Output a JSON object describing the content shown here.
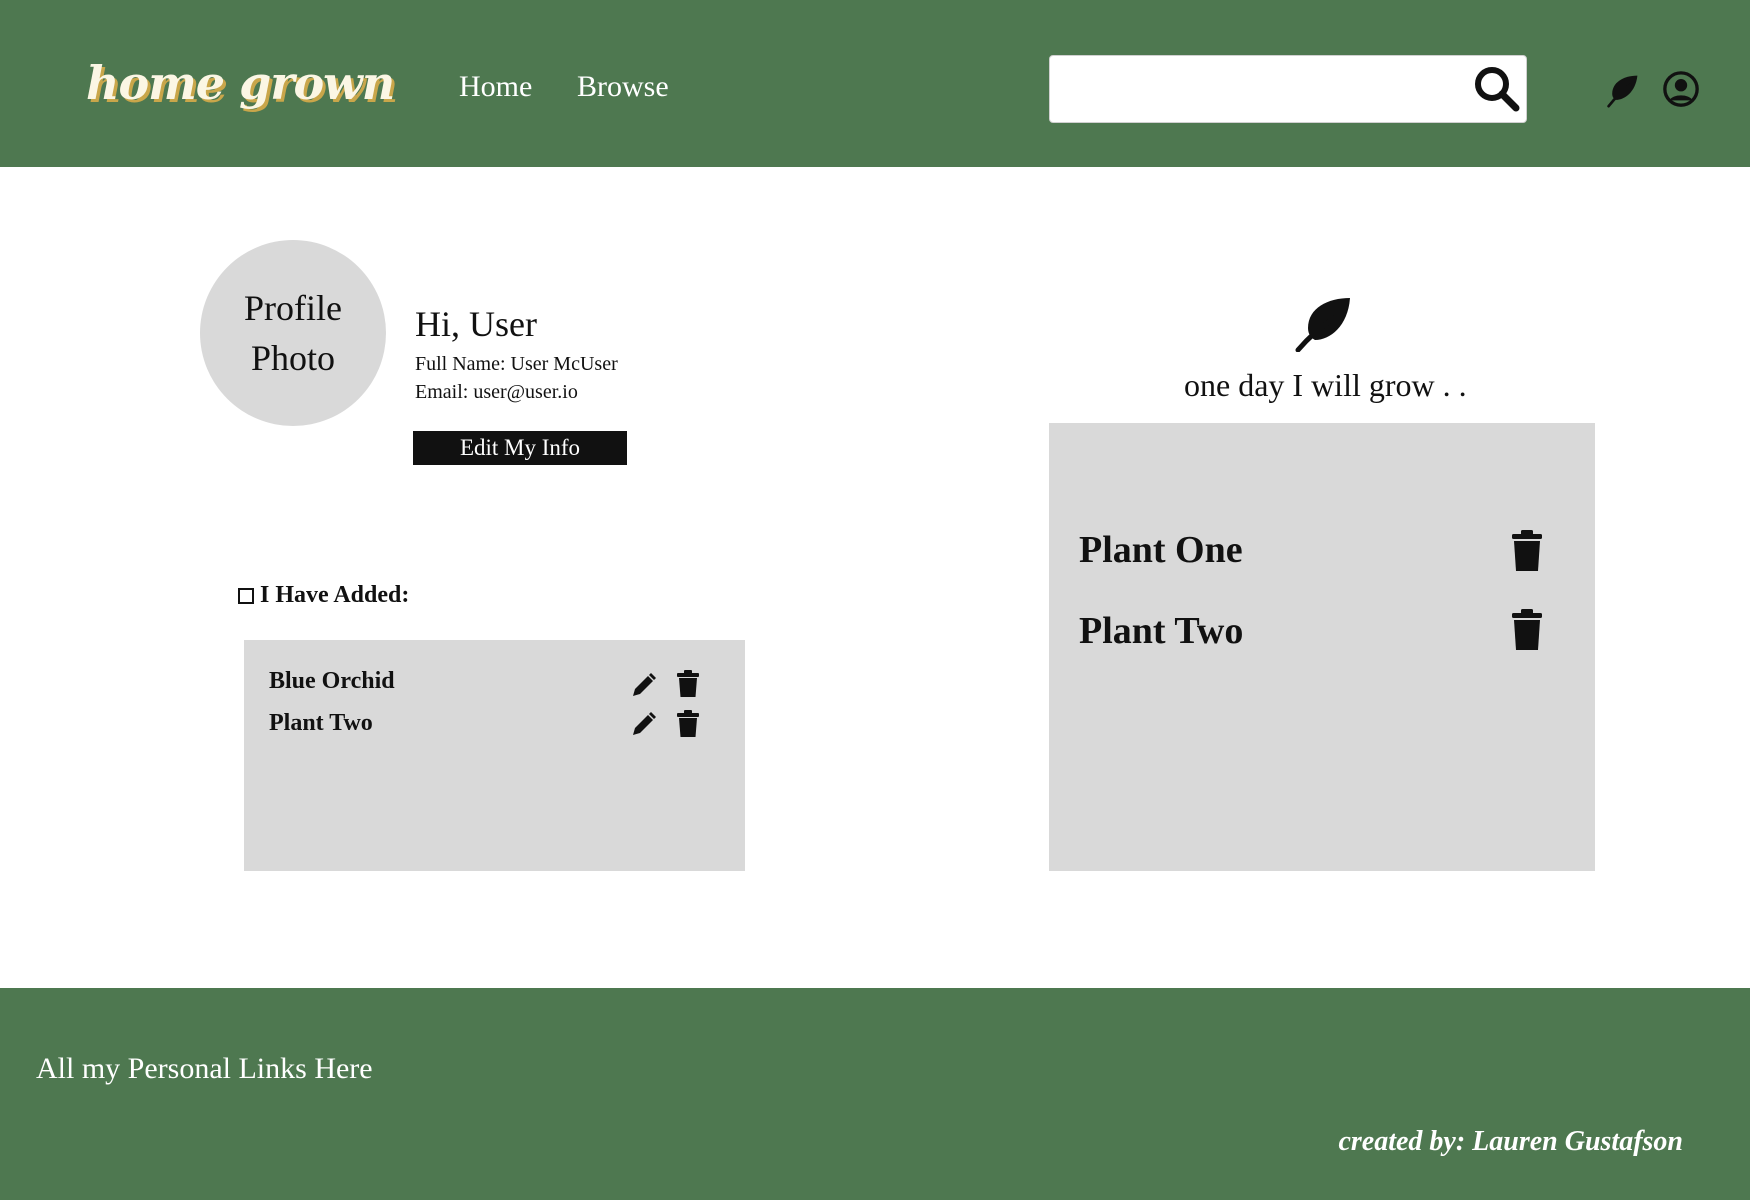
{
  "header": {
    "logo": "home grown",
    "nav": {
      "home": "Home",
      "browse": "Browse"
    },
    "search": {
      "placeholder": "",
      "value": ""
    },
    "icons": [
      "search-icon",
      "leaf-icon",
      "user-icon"
    ]
  },
  "profile": {
    "photo_label": "Profile Photo",
    "greeting": "Hi, User",
    "full_name": "Full Name: User McUser",
    "email": "Email: user@user.io",
    "edit_button": "Edit My Info"
  },
  "added": {
    "heading": "I Have Added:",
    "items": [
      {
        "name": "Blue Orchid"
      },
      {
        "name": "Plant Two"
      }
    ]
  },
  "wishlist": {
    "title": "one day I will grow . .",
    "items": [
      {
        "name": "Plant One"
      },
      {
        "name": "Plant Two"
      }
    ]
  },
  "footer": {
    "links": "All my Personal Links Here",
    "credit": "created by: Lauren Gustafson"
  },
  "colors": {
    "brand_green": "#4e7850",
    "panel_gray": "#d9d9d9",
    "logo_cream": "#fbf6e4",
    "logo_shadow": "#c9a64a"
  }
}
